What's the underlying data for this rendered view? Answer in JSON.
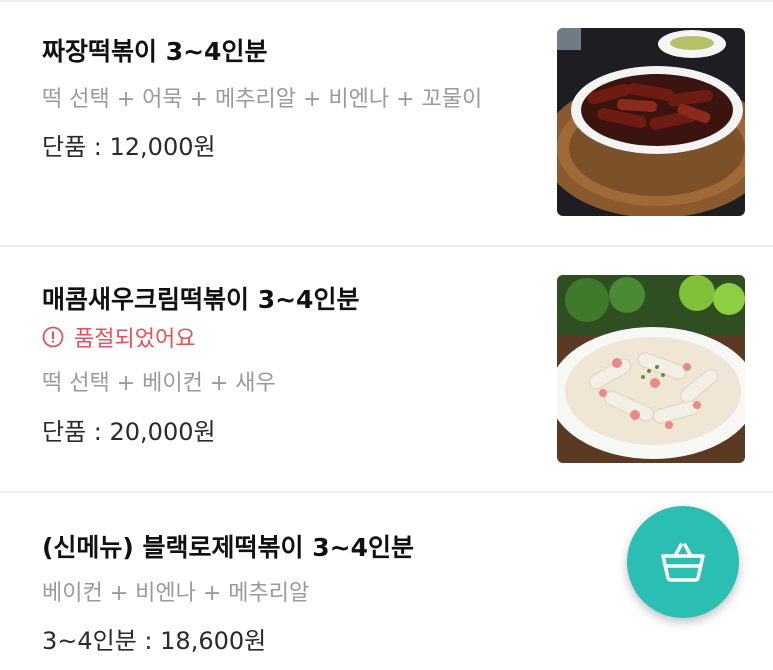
{
  "menu": {
    "items": [
      {
        "name": "짜장떡볶이 3~4인분",
        "options": "떡 선택 + 어묵 + 메추리알 + 비엔나 + 꼬물이",
        "price": "단품 : 12,000원",
        "image_icon": "jjajang-tteokbokki-photo"
      },
      {
        "name": "매콤새우크림떡볶이 3~4인분",
        "status": "품절되었어요",
        "options": "떡 선택 + 베이컨 + 새우",
        "price": "단품 : 20,000원",
        "image_icon": "shrimp-cream-tteokbokki-photo"
      },
      {
        "name": "(신메뉴) 블랙로제떡볶이 3~4인분",
        "options": "베이컨 + 비엔나 + 메추리알",
        "price": "3~4인분 : 18,600원"
      }
    ]
  },
  "cart_button": {
    "icon": "basket-icon"
  },
  "colors": {
    "accent": "#2bbfb4",
    "soldout": "#e0535a",
    "secondary_text": "#9a9a9a"
  }
}
